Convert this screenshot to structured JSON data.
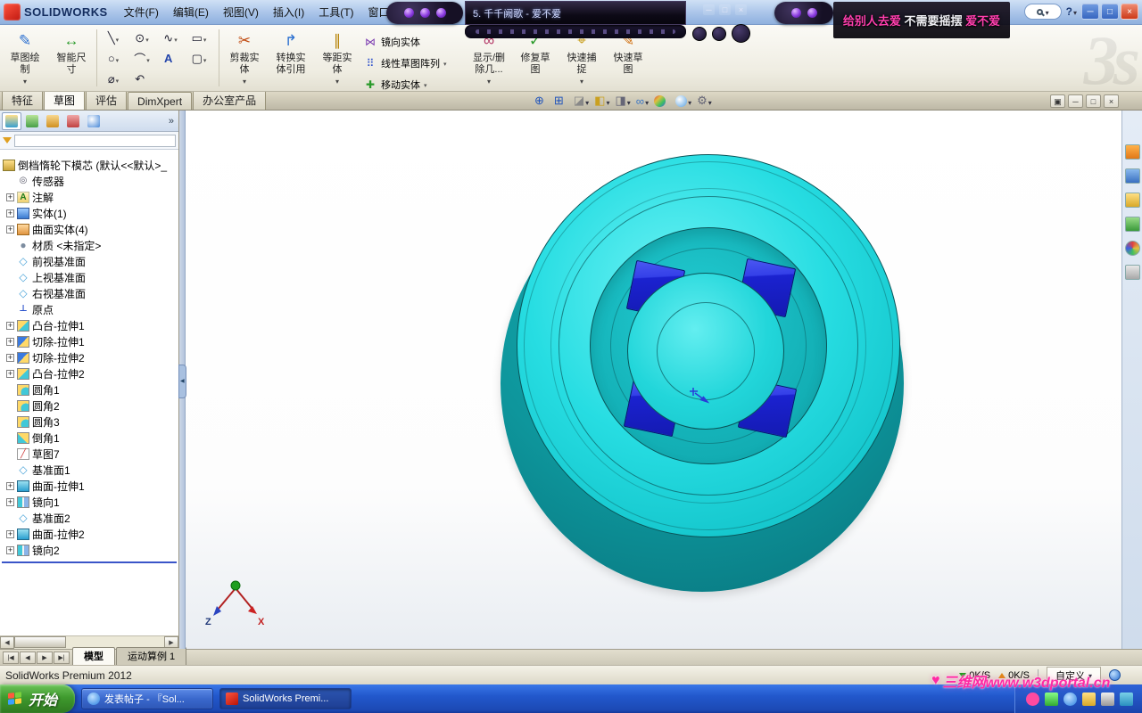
{
  "titlebar": {
    "app_title": "SOLIDWORKS",
    "menus": [
      "文件(F)",
      "编辑(E)",
      "视图(V)",
      "插入(I)",
      "工具(T)",
      "窗口(W)"
    ],
    "help_label": "?",
    "window_controls": [
      {
        "name": "minimize-button",
        "icon": "minimize-icon",
        "glyph": "─"
      },
      {
        "name": "restore-button",
        "icon": "restore-icon",
        "glyph": "□"
      },
      {
        "name": "close-button",
        "icon": "close-icon",
        "glyph": "×"
      }
    ]
  },
  "player": {
    "track": "5. 千千阙歌 - 爱不爱",
    "mini_controls": [
      {
        "name": "player-minimize-button",
        "glyph": "─"
      },
      {
        "name": "player-restore-button",
        "glyph": "□"
      },
      {
        "name": "player-close-button",
        "glyph": "×"
      }
    ],
    "lyrics": [
      {
        "text": "给别人去爱",
        "color": "#ff3fae"
      },
      {
        "text": " 不需要摇摆 ",
        "color": "#efeff4"
      },
      {
        "text": "爱不爱",
        "color": "#ff3fae"
      }
    ]
  },
  "ribbon": {
    "left_buttons": [
      {
        "name": "sketch-button",
        "icon": "sketch-draw-icon",
        "glyph": "✎",
        "label": "草图绘\n制",
        "caret": true
      },
      {
        "name": "smart-dimension-button",
        "icon": "smart-dimension-icon",
        "glyph": "↔",
        "label": "智能尺\n寸",
        "caret": false
      }
    ],
    "tool_grid": [
      {
        "name": "line-tool-button",
        "icon": "line-icon",
        "glyph": "╲",
        "caret": true
      },
      {
        "name": "circle-tool-button",
        "icon": "circle-icon",
        "glyph": "⊙",
        "caret": true
      },
      {
        "name": "spline-tool-button",
        "icon": "spline-icon",
        "glyph": "∿",
        "caret": true
      },
      {
        "name": "rectangle-tool-button",
        "icon": "rectangle-icon",
        "glyph": "▭",
        "caret": true
      },
      {
        "name": "ellipse-tool-button",
        "icon": "ellipse-icon",
        "glyph": "○",
        "caret": true
      },
      {
        "name": "sketch-fillet-button",
        "icon": "sketch-fillet-icon",
        "glyph": "⌒",
        "caret": true
      },
      {
        "name": "text-tool-button",
        "icon": "text-icon",
        "glyph": "A",
        "caret": false
      },
      {
        "name": "slot-tool-button",
        "icon": "slot-icon",
        "glyph": "▢",
        "caret": true
      },
      {
        "name": "point-tool-button",
        "icon": "point-icon",
        "glyph": "⌀",
        "caret": true
      },
      {
        "name": "undo-button",
        "icon": "undo-icon",
        "glyph": "↶",
        "caret": false
      }
    ],
    "mid_buttons": [
      {
        "name": "trim-entities-button",
        "icon": "trim-entities-icon",
        "glyph": "✂",
        "label": "剪裁实\n体",
        "caret": true
      },
      {
        "name": "convert-entities-button",
        "icon": "convert-entities-icon",
        "glyph": "↱",
        "label": "转换实\n体引用",
        "caret": false
      },
      {
        "name": "offset-entities-button",
        "icon": "offset-entities-icon",
        "glyph": "∥",
        "label": "等距实\n体",
        "caret": true
      }
    ],
    "stack_buttons": [
      {
        "name": "mirror-entities-button",
        "icon": "mirror-entities-icon",
        "glyph": "⋈",
        "label": "镜向实体",
        "caret": false
      },
      {
        "name": "linear-sketch-pattern-button",
        "icon": "linear-pattern-icon",
        "glyph": "⠿",
        "label": "线性草图阵列",
        "caret": true
      },
      {
        "name": "move-entities-button",
        "icon": "move-entities-icon",
        "glyph": "✚",
        "label": "移动实体",
        "caret": true
      }
    ],
    "right_buttons": [
      {
        "name": "display-delete-relations-button",
        "icon": "display-relations-icon",
        "glyph": "∞",
        "label": "显示/删\n除几...",
        "caret": true
      },
      {
        "name": "repair-sketch-button",
        "icon": "repair-sketch-icon",
        "glyph": "✓",
        "label": "修复草\n图",
        "caret": false
      },
      {
        "name": "quick-snaps-button",
        "icon": "quick-snaps-icon",
        "glyph": "⌖",
        "label": "快速捕\n捉",
        "caret": true
      },
      {
        "name": "rapid-sketch-button",
        "icon": "rapid-sketch-icon",
        "glyph": "✎",
        "label": "快速草\n图",
        "caret": false
      }
    ],
    "watermark": "3s"
  },
  "command_tabs": [
    {
      "label": "特征",
      "state": "normal"
    },
    {
      "label": "草图",
      "state": "active"
    },
    {
      "label": "评估",
      "state": "normal"
    },
    {
      "label": "DimXpert",
      "state": "normal"
    },
    {
      "label": "办公室产品",
      "state": "normal"
    }
  ],
  "fm_panel": {
    "tabs": [
      {
        "icon": "feature-manager-tab-icon",
        "state": "active"
      },
      {
        "icon": "property-manager-tab-icon",
        "state": "normal"
      },
      {
        "icon": "configuration-manager-tab-icon",
        "state": "normal"
      },
      {
        "icon": "dimxpert-manager-tab-icon",
        "state": "normal"
      },
      {
        "icon": "display-manager-tab-icon",
        "state": "normal"
      }
    ],
    "chevron": "»"
  },
  "feature_tree": {
    "root": {
      "label": "倒档惰轮下模芯 (默认<<默认>_",
      "icon": "part-icon"
    },
    "items": [
      {
        "label": "传感器",
        "icon": "sensors-icon",
        "glyph": "◎",
        "expand": false
      },
      {
        "label": "注解",
        "icon": "annotations-icon",
        "glyph": "A",
        "expand": true
      },
      {
        "label": "实体(1)",
        "icon": "solid-bodies-icon",
        "expand": true
      },
      {
        "label": "曲面实体(4)",
        "icon": "surface-bodies-icon",
        "expand": true
      },
      {
        "label": "材质 <未指定>",
        "icon": "material-icon",
        "glyph": "●",
        "expand": false
      },
      {
        "label": "前视基准面",
        "icon": "plane-icon",
        "glyph": "◇",
        "expand": false
      },
      {
        "label": "上视基准面",
        "icon": "plane-icon",
        "glyph": "◇",
        "expand": false
      },
      {
        "label": "右视基准面",
        "icon": "plane-icon",
        "glyph": "◇",
        "expand": false
      },
      {
        "label": "原点",
        "icon": "origin-icon",
        "glyph": "⊥",
        "expand": false
      },
      {
        "label": "凸台-拉伸1",
        "icon": "boss-extrude-icon",
        "expand": true
      },
      {
        "label": "切除-拉伸1",
        "icon": "cut-extrude-icon",
        "expand": true
      },
      {
        "label": "切除-拉伸2",
        "icon": "cut-extrude-icon",
        "expand": true
      },
      {
        "label": "凸台-拉伸2",
        "icon": "boss-extrude-icon",
        "expand": true
      },
      {
        "label": "圆角1",
        "icon": "fillet-icon",
        "expand": false
      },
      {
        "label": "圆角2",
        "icon": "fillet-icon",
        "expand": false
      },
      {
        "label": "圆角3",
        "icon": "fillet-icon",
        "expand": false
      },
      {
        "label": "倒角1",
        "icon": "chamfer-icon",
        "expand": false
      },
      {
        "label": "草图7",
        "icon": "sketch-icon",
        "glyph": "╱",
        "expand": false
      },
      {
        "label": "基准面1",
        "icon": "plane-icon",
        "glyph": "◇",
        "expand": false
      },
      {
        "label": "曲面-拉伸1",
        "icon": "surface-extrude-icon",
        "expand": true
      },
      {
        "label": "镜向1",
        "icon": "mirror-feature-icon",
        "expand": true
      },
      {
        "label": "基准面2",
        "icon": "plane-icon",
        "glyph": "◇",
        "expand": false
      },
      {
        "label": "曲面-拉伸2",
        "icon": "surface-extrude-icon",
        "expand": true
      },
      {
        "label": "镜向2",
        "icon": "mirror-feature-icon",
        "expand": true
      }
    ]
  },
  "hud": [
    {
      "name": "zoom-fit-button",
      "icon": "zoom-fit-icon",
      "glyph": "⊕",
      "caret": false
    },
    {
      "name": "zoom-area-button",
      "icon": "zoom-area-icon",
      "glyph": "⊞",
      "caret": false
    },
    {
      "name": "section-view-button",
      "icon": "section-view-icon",
      "glyph": "◪",
      "caret": true
    },
    {
      "name": "view-orientation-button",
      "icon": "view-orientation-icon",
      "glyph": "◧",
      "caret": true
    },
    {
      "name": "display-style-button",
      "icon": "display-style-icon",
      "glyph": "◨",
      "caret": true
    },
    {
      "name": "hide-show-items-button",
      "icon": "hide-show-icon",
      "glyph": "∞",
      "caret": true
    },
    {
      "name": "edit-appearance-button",
      "icon": "edit-appearance-icon",
      "glyph": "●",
      "caret": false
    },
    {
      "name": "apply-scene-button",
      "icon": "apply-scene-icon",
      "glyph": "◐",
      "caret": true
    },
    {
      "name": "view-settings-button",
      "icon": "view-settings-icon",
      "glyph": "⚙",
      "caret": true
    }
  ],
  "doc_controls": [
    {
      "name": "viewport-layout-button",
      "icon": "viewport-layout-icon",
      "glyph": "▣"
    },
    {
      "name": "doc-minimize-button",
      "icon": "doc-minimize-icon",
      "glyph": "─"
    },
    {
      "name": "doc-restore-button",
      "icon": "doc-restore-icon",
      "glyph": "□"
    },
    {
      "name": "doc-close-button",
      "icon": "doc-close-icon",
      "glyph": "×"
    }
  ],
  "task_pane": [
    {
      "name": "solidworks-resources-button",
      "icon": "home-icon"
    },
    {
      "name": "design-library-button",
      "icon": "library-icon"
    },
    {
      "name": "file-explorer-button",
      "icon": "folder-icon"
    },
    {
      "name": "view-palette-button",
      "icon": "palette-icon"
    },
    {
      "name": "appearances-button",
      "icon": "appearances-icon"
    },
    {
      "name": "custom-properties-button",
      "icon": "properties-icon"
    }
  ],
  "model_tabs": {
    "nav": [
      {
        "name": "first-tab-button",
        "glyph": "|◀"
      },
      {
        "name": "prev-tab-button",
        "glyph": "◀"
      },
      {
        "name": "next-tab-button",
        "glyph": "▶"
      },
      {
        "name": "last-tab-button",
        "glyph": "▶|"
      }
    ],
    "tabs": [
      {
        "label": "模型",
        "state": "active"
      },
      {
        "label": "运动算例 1",
        "state": "normal"
      }
    ]
  },
  "triad": {
    "z": "Z",
    "x": "X"
  },
  "statusbar": {
    "left": "SolidWorks Premium 2012",
    "net_down": "0K/S",
    "net_up": "0K/S",
    "custom_label": "自定义"
  },
  "taskbar": {
    "start_label": "开始",
    "buttons": [
      {
        "label": "发表帖子 - 『Sol...",
        "icon": "ie-icon",
        "state": "normal"
      },
      {
        "label": "SolidWorks Premi...",
        "icon": "solidworks-icon",
        "state": "active"
      }
    ],
    "tray_icons": [
      {
        "icon": "tray-icon-1"
      },
      {
        "icon": "tray-icon-2"
      },
      {
        "icon": "tray-icon-3"
      },
      {
        "icon": "tray-icon-4"
      },
      {
        "icon": "tray-icon-5"
      },
      {
        "icon": "tray-icon-6"
      }
    ]
  },
  "watermark": {
    "site": "三维网www.w3dportal.cn",
    "heart": "♥"
  }
}
